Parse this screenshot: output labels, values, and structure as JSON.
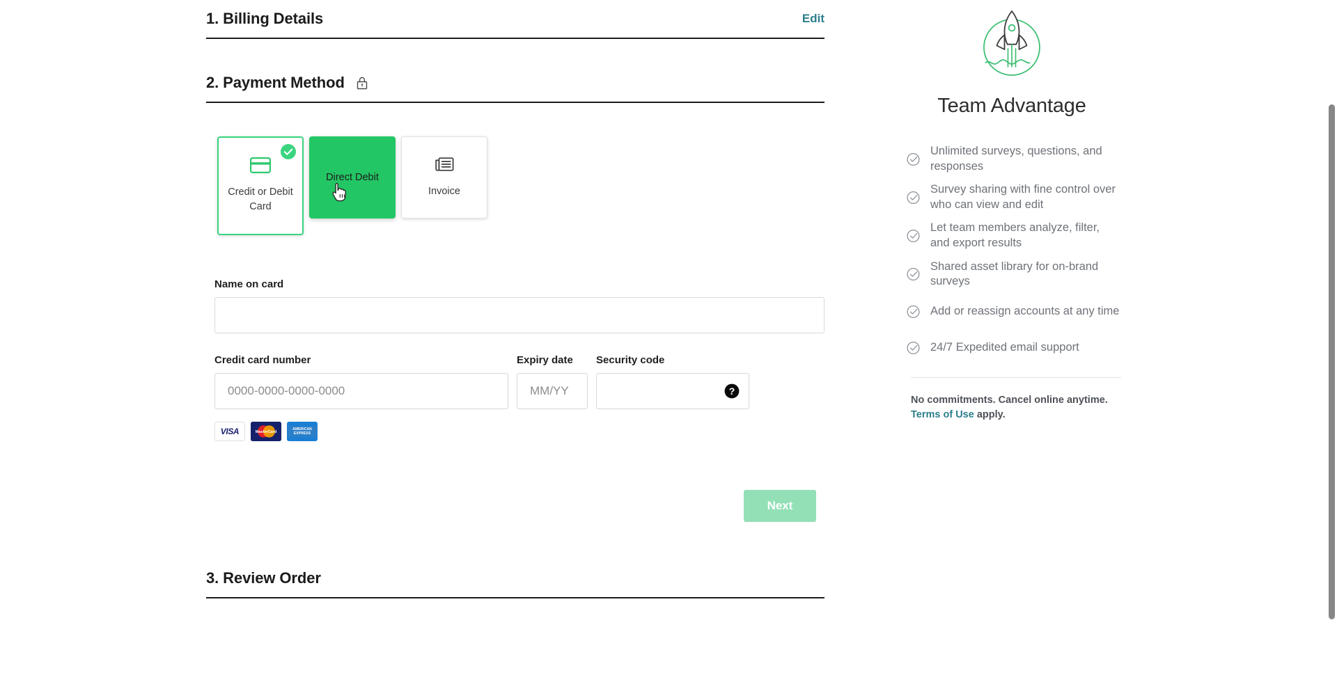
{
  "steps": {
    "billing": {
      "title": "1. Billing Details",
      "edit_label": "Edit"
    },
    "payment": {
      "title": "2. Payment Method",
      "lock_icon": "lock-icon"
    },
    "review": {
      "title": "3. Review Order"
    }
  },
  "payment_methods": [
    {
      "label": "Credit or Debit Card",
      "icon": "credit-card-icon",
      "state": "selected"
    },
    {
      "label": "Direct Debit",
      "icon": "bank-icon",
      "state": "hovered"
    },
    {
      "label": "Invoice",
      "icon": "invoice-icon",
      "state": "default"
    }
  ],
  "form": {
    "name_on_card": {
      "label": "Name on card",
      "value": "",
      "placeholder": ""
    },
    "card_number": {
      "label": "Credit card number",
      "value": "",
      "placeholder": "0000-0000-0000-0000"
    },
    "expiry": {
      "label": "Expiry date",
      "value": "",
      "placeholder": "MM/YY"
    },
    "security_code": {
      "label": "Security code",
      "value": "",
      "placeholder": "",
      "help_icon": "question-mark-icon"
    }
  },
  "card_brands": [
    {
      "name": "visa",
      "label": "VISA"
    },
    {
      "name": "mastercard",
      "label": "MasterCard"
    },
    {
      "name": "american-express",
      "label": "AMERICAN EXPRESS"
    }
  ],
  "actions": {
    "next_label": "Next"
  },
  "sidebar": {
    "icon": "rocket-icon",
    "title": "Team Advantage",
    "features": [
      "Unlimited surveys, questions, and responses",
      "Survey sharing with fine control over who can view and edit",
      "Let team members analyze, filter, and export results",
      "Shared asset library for on-brand surveys",
      "Add or reassign accounts at any time",
      "24/7 Expedited email support"
    ],
    "footer": {
      "text_before": "No commitments. Cancel online anytime. ",
      "link_label": "Terms of Use",
      "text_after": " apply."
    }
  },
  "colors": {
    "accent_green": "#23c664",
    "selected_border": "#3ad47f",
    "link_teal": "#2b7e8c",
    "next_disabled": "#93e0b6"
  }
}
